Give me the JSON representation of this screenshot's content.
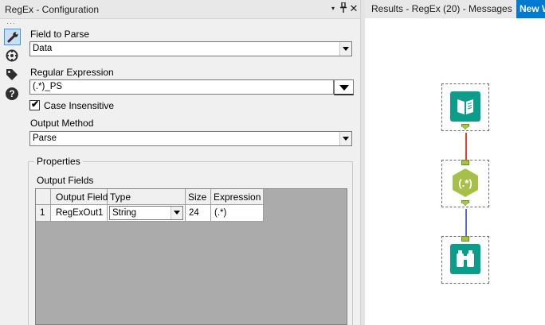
{
  "config_panel": {
    "title": "RegEx - Configuration",
    "header_buttons": {
      "dropdown": "▾",
      "pin": "📌",
      "close": "✕"
    },
    "strip_icons": [
      "configuration-wrench-icon",
      "anchor-icon",
      "tag-icon",
      "help-icon"
    ],
    "help_glyph": "?",
    "field_to_parse": {
      "label": "Field to Parse",
      "value": "Data"
    },
    "regular_expression": {
      "label": "Regular Expression",
      "value": "(.*)_PS"
    },
    "case_insensitive": {
      "label": "Case Insensitive",
      "checked": true,
      "mark": "✔"
    },
    "output_method": {
      "label": "Output Method",
      "value": "Parse"
    },
    "properties": {
      "label": "Properties",
      "output_fields_label": "Output Fields",
      "columns": [
        "Output Field",
        "Type",
        "Size",
        "Expression"
      ],
      "rows": [
        {
          "row_number": "1",
          "output_field": "RegExOut1",
          "type": "String",
          "size": "24",
          "expression": "(.*)"
        }
      ]
    }
  },
  "canvas": {
    "tabs": [
      {
        "label": "Results - RegEx (20) - Messages",
        "active": false
      },
      {
        "label": "New W",
        "active": true
      }
    ],
    "tools": [
      {
        "name": "input-data-tool",
        "icon": "book-icon",
        "color": "#0a9e8a"
      },
      {
        "name": "regex-tool",
        "icon": "regex-hexagon-icon",
        "glyph": "(.*)",
        "color": "#a7c04a"
      },
      {
        "name": "browse-tool",
        "icon": "binoculars-icon",
        "color": "#0a9e8a"
      }
    ],
    "connections": [
      {
        "from": "input-data-tool",
        "to": "regex-tool",
        "color": "#e23c3c"
      },
      {
        "from": "regex-tool",
        "to": "browse-tool",
        "color": "#5a6de0"
      }
    ]
  }
}
